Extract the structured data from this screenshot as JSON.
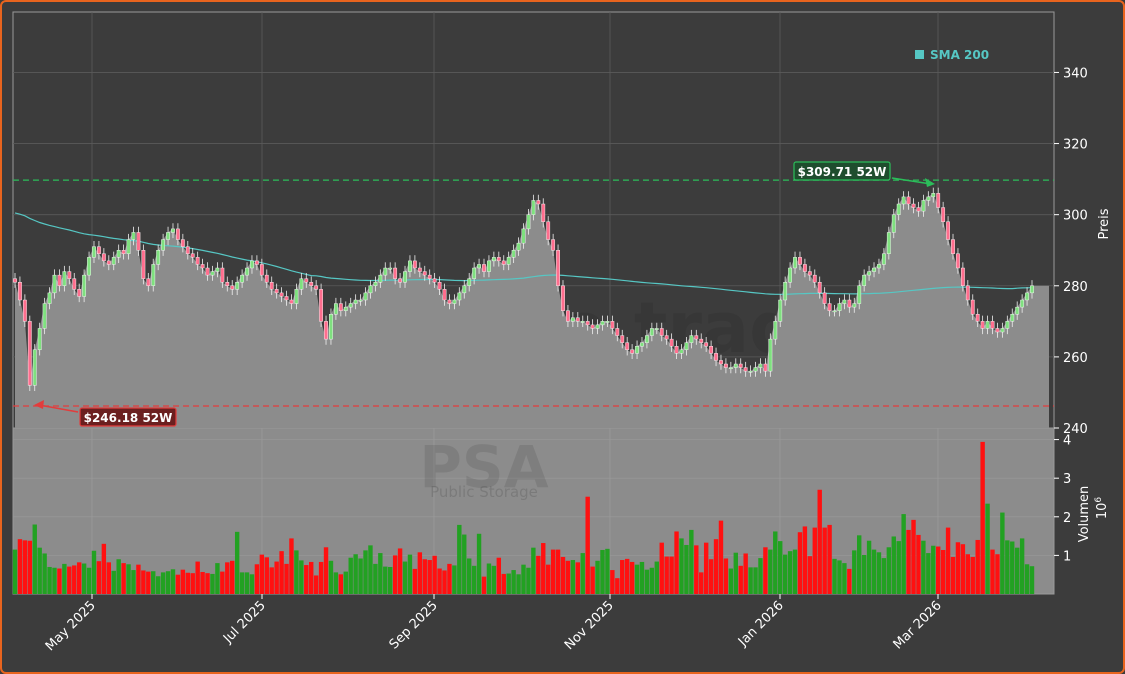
{
  "colors": {
    "background": "#3c3c3c",
    "border": "#e8641e",
    "up": "#22a122",
    "down": "#ff1010",
    "sma": "#56c7c4",
    "high_line": "#2bbd5a",
    "low_line": "#e23c3c",
    "area": "#8c8c8c"
  },
  "chart_data": {
    "type": "candlestick",
    "watermark": "forexsignale.trade",
    "ticker": "PSA",
    "company": "Public Storage",
    "legend": {
      "label": "SMA 200",
      "position": "top-right"
    },
    "price_axis": {
      "label": "Preis",
      "ylim": [
        240,
        357
      ],
      "ticks": [
        240,
        260,
        280,
        300,
        320,
        340
      ]
    },
    "volume_axis": {
      "label": "Volumen",
      "multiplier": "10",
      "exponent": "6",
      "ylim": [
        0,
        4.3
      ],
      "ticks": [
        1,
        2,
        3,
        4
      ]
    },
    "x_ticks": [
      "May 2025",
      "Jul 2025",
      "Sep 2025",
      "Nov 2025",
      "Jan 2026",
      "Mar 2026"
    ],
    "high_52w": {
      "value": 309.71,
      "label": "$309.71 52W"
    },
    "low_52w": {
      "value": 246.18,
      "label": "$246.18 52W"
    },
    "grid": true,
    "last_close": 280,
    "close": [
      281,
      276,
      270,
      252,
      262,
      268,
      275,
      278,
      283,
      280,
      284,
      282,
      279,
      277,
      283,
      288,
      291,
      289,
      287,
      286,
      288,
      290,
      289,
      293,
      295,
      290,
      282,
      280,
      286,
      290,
      293,
      295,
      296,
      293,
      291,
      289,
      288,
      286,
      285,
      283,
      284,
      285,
      281,
      280,
      279,
      281,
      283,
      285,
      287,
      286,
      283,
      281,
      279,
      278,
      277,
      276,
      275,
      279,
      282,
      281,
      280,
      279,
      270,
      265,
      272,
      275,
      273,
      274,
      275,
      276,
      276,
      278,
      280,
      281,
      283,
      285,
      285,
      282,
      281,
      284,
      287,
      285,
      284,
      283,
      282,
      281,
      279,
      276,
      275,
      276,
      278,
      280,
      282,
      285,
      286,
      284,
      287,
      288,
      287,
      286,
      288,
      290,
      292,
      296,
      300,
      304,
      303,
      298,
      293,
      290,
      280,
      273,
      270,
      271,
      270,
      270,
      269,
      268,
      269,
      270,
      270,
      268,
      266,
      264,
      262,
      261,
      263,
      264,
      266,
      268,
      268,
      266,
      265,
      263,
      261,
      262,
      264,
      266,
      265,
      264,
      263,
      261,
      259,
      258,
      257,
      257,
      258,
      257,
      256,
      256,
      257,
      258,
      256,
      265,
      270,
      276,
      281,
      285,
      288,
      286,
      284,
      283,
      281,
      278,
      275,
      273,
      273,
      275,
      276,
      274,
      275,
      280,
      283,
      284,
      285,
      286,
      289,
      295,
      300,
      303,
      305,
      303,
      302,
      301,
      304,
      305,
      306,
      302,
      298,
      293,
      289,
      285,
      280,
      276,
      272,
      270,
      268,
      270,
      268,
      267,
      268,
      270,
      272,
      274,
      276,
      278,
      280
    ],
    "volume": [
      1.15,
      1.42,
      1.39,
      1.38,
      1.8,
      1.2,
      1.05,
      0.7,
      0.68,
      0.66,
      0.78,
      0.71,
      0.74,
      0.82,
      0.79,
      0.68,
      1.12,
      0.85,
      1.3,
      0.82,
      0.6,
      0.9,
      0.8,
      0.77,
      0.62,
      0.76,
      0.61,
      0.58,
      0.59,
      0.46,
      0.56,
      0.59,
      0.64,
      0.5,
      0.63,
      0.55,
      0.54,
      0.84,
      0.57,
      0.54,
      0.52,
      0.8,
      0.58,
      0.82,
      0.86,
      1.61,
      0.56,
      0.56,
      0.51,
      0.77,
      1.02,
      0.95,
      0.69,
      0.84,
      1.11,
      0.78,
      1.44,
      1.13,
      0.87,
      0.75,
      0.83,
      0.48,
      0.83,
      1.21,
      0.86,
      0.56,
      0.51,
      0.58,
      0.94,
      1.03,
      0.92,
      1.13,
      1.26,
      0.78,
      1.06,
      0.71,
      0.7,
      1.0,
      1.18,
      0.84,
      1.02,
      0.65,
      1.08,
      0.9,
      0.88,
      0.99,
      0.66,
      0.61,
      0.78,
      0.74,
      1.79,
      1.54,
      0.92,
      0.73,
      1.56,
      0.45,
      0.79,
      0.73,
      0.94,
      0.52,
      0.53,
      0.62,
      0.51,
      0.76,
      0.68,
      1.2,
      0.99,
      1.32,
      0.76,
      1.15,
      1.15,
      0.96,
      0.86,
      0.88,
      0.82,
      1.06,
      2.52,
      0.71,
      0.86,
      1.14,
      1.17,
      0.62,
      0.41,
      0.88,
      0.91,
      0.83,
      0.76,
      0.83,
      0.63,
      0.68,
      0.84,
      1.33,
      0.97,
      0.97,
      1.62,
      1.44,
      1.27,
      1.66,
      1.26,
      0.56,
      1.33,
      0.9,
      1.42,
      1.9,
      0.92,
      0.66,
      1.07,
      0.73,
      1.05,
      0.69,
      0.69,
      0.93,
      1.21,
      1.15,
      1.62,
      1.37,
      1.02,
      1.11,
      1.15,
      1.6,
      1.75,
      0.98,
      1.72,
      2.7,
      1.72,
      1.79,
      0.91,
      0.87,
      0.8,
      0.65,
      1.13,
      1.52,
      1.01,
      1.38,
      1.15,
      1.08,
      0.93,
      1.21,
      1.49,
      1.37,
      2.07,
      1.66,
      1.92,
      1.53,
      1.38,
      1.06,
      1.25,
      1.23,
      1.14,
      1.72,
      0.96,
      1.34,
      1.29,
      1.03,
      0.96,
      1.4,
      3.94,
      2.34,
      1.15,
      1.03,
      2.11,
      1.39,
      1.36,
      1.2,
      1.44,
      0.77,
      0.72,
      1.31,
      1.59,
      0.73,
      0.93,
      1.61,
      0.95,
      0.65
    ]
  }
}
